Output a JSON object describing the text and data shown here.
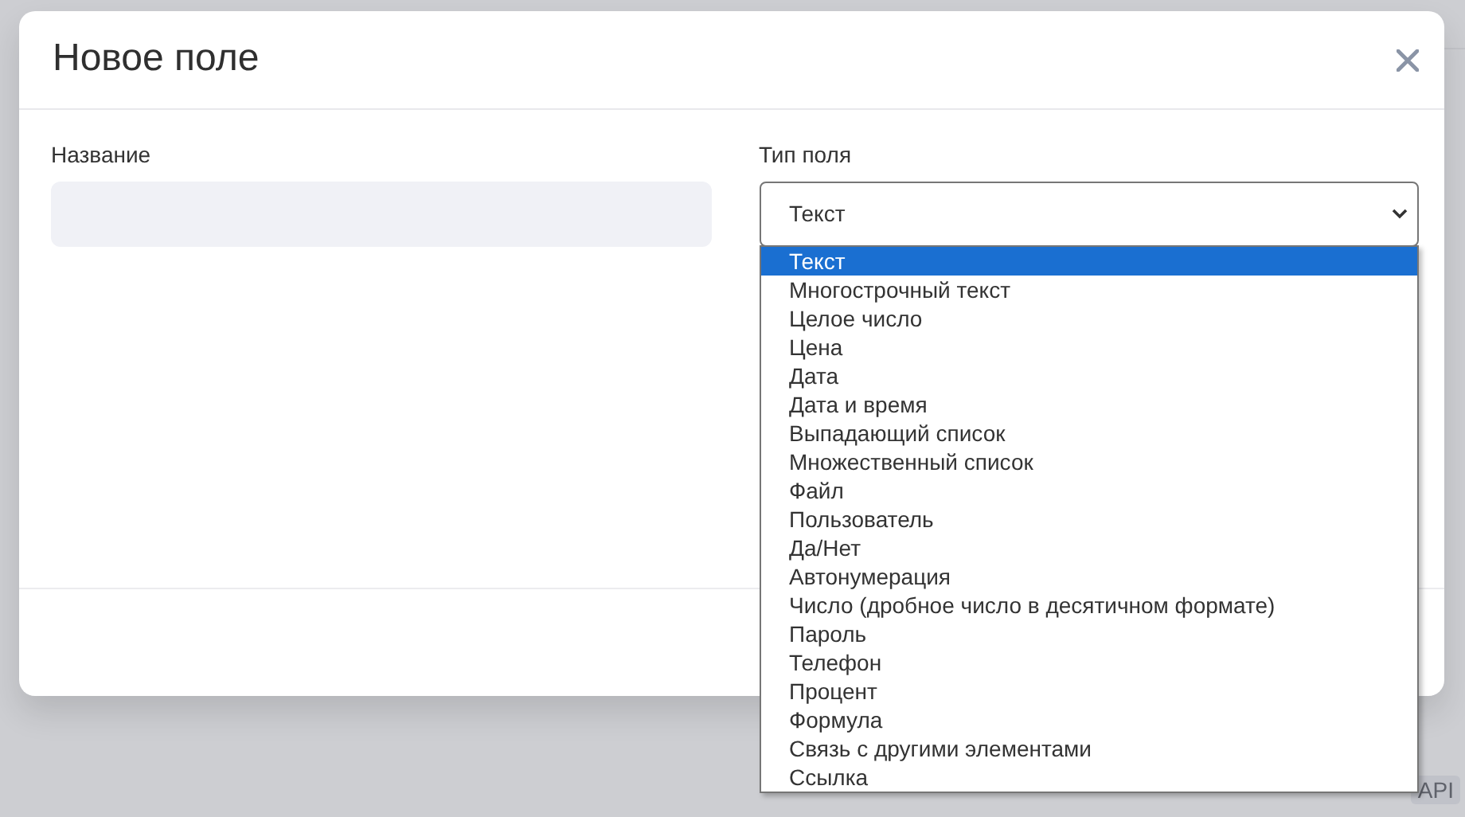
{
  "background": {
    "tags": [
      "API"
    ]
  },
  "dialog": {
    "title": "Новое поле",
    "fields": [
      {
        "kind": "text",
        "label": "Название"
      },
      {
        "kind": "select",
        "label": "Тип поля",
        "value": "Текст",
        "expanded": true,
        "options": [
          {
            "label": "Текст",
            "selected": true
          },
          {
            "label": "Многострочный текст",
            "selected": false
          },
          {
            "label": "Целое число",
            "selected": false
          },
          {
            "label": "Цена",
            "selected": false
          },
          {
            "label": "Дата",
            "selected": false
          },
          {
            "label": "Дата и время",
            "selected": false
          },
          {
            "label": "Выпадающий список",
            "selected": false
          },
          {
            "label": "Множественный список",
            "selected": false
          },
          {
            "label": "Файл",
            "selected": false
          },
          {
            "label": "Пользователь",
            "selected": false
          },
          {
            "label": "Да/Нет",
            "selected": false
          },
          {
            "label": "Автонумерация",
            "selected": false
          },
          {
            "label": "Число (дробное число в десятичном формате)",
            "selected": false
          },
          {
            "label": "Пароль",
            "selected": false
          },
          {
            "label": "Телефон",
            "selected": false
          },
          {
            "label": "Процент",
            "selected": false
          },
          {
            "label": "Формула",
            "selected": false
          },
          {
            "label": "Связь с другими элементами",
            "selected": false
          },
          {
            "label": "Ссылка",
            "selected": false
          }
        ]
      }
    ]
  }
}
